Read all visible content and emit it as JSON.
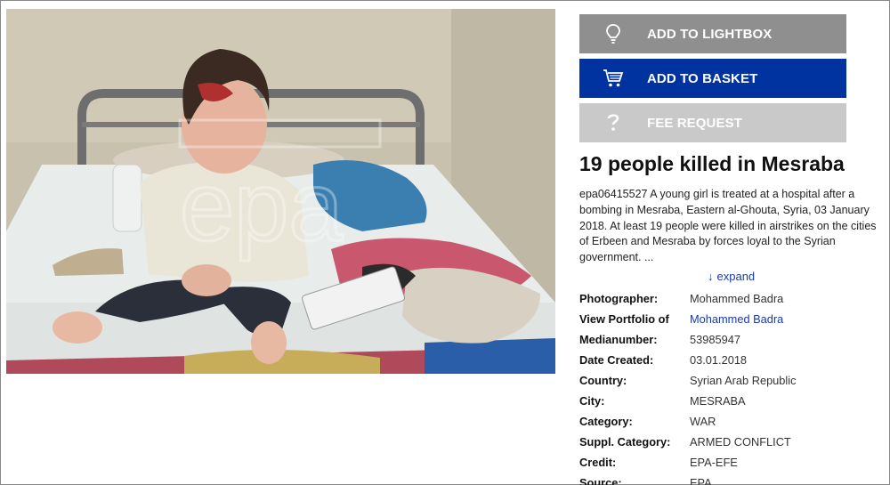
{
  "buttons": {
    "lightbox_label": "ADD TO LIGHTBOX",
    "basket_label": "ADD TO BASKET",
    "fee_label": "FEE REQUEST"
  },
  "icons": {
    "lightbox": "lightbulb-icon",
    "basket": "cart-icon",
    "fee": "question-icon"
  },
  "colors": {
    "lightbox_bg": "#8f8f8f",
    "basket_bg": "#0033a0",
    "fee_bg": "#c9c9c9",
    "link": "#1a3aa8"
  },
  "photo": {
    "watermark": "epa"
  },
  "story": {
    "title": "19 people killed in Mesraba",
    "description": "epa06415527 A young girl is treated at a hospital after a bombing in Mesraba, Eastern al-Ghouta, Syria, 03 January 2018. At least 19 people were killed in airstrikes on the cities of Erbeen and Mesraba by forces loyal to the Syrian government. ...",
    "expand_label": "expand",
    "expand_arrow": "↓"
  },
  "meta": [
    {
      "key": "Photographer:",
      "value": "Mohammed Badra",
      "link": false
    },
    {
      "key": "View Portfolio of",
      "value": "Mohammed Badra",
      "link": true
    },
    {
      "key": "Medianumber:",
      "value": "53985947",
      "link": false
    },
    {
      "key": "Date Created:",
      "value": "03.01.2018",
      "link": false
    },
    {
      "key": "Country:",
      "value": "Syrian Arab Republic",
      "link": false
    },
    {
      "key": "City:",
      "value": "MESRABA",
      "link": false
    },
    {
      "key": "Category:",
      "value": "WAR",
      "link": false
    },
    {
      "key": "Suppl. Category:",
      "value": "ARMED CONFLICT",
      "link": false
    },
    {
      "key": "Credit:",
      "value": "EPA-EFE",
      "link": false
    },
    {
      "key": "Source:",
      "value": "EPA",
      "link": false
    }
  ]
}
